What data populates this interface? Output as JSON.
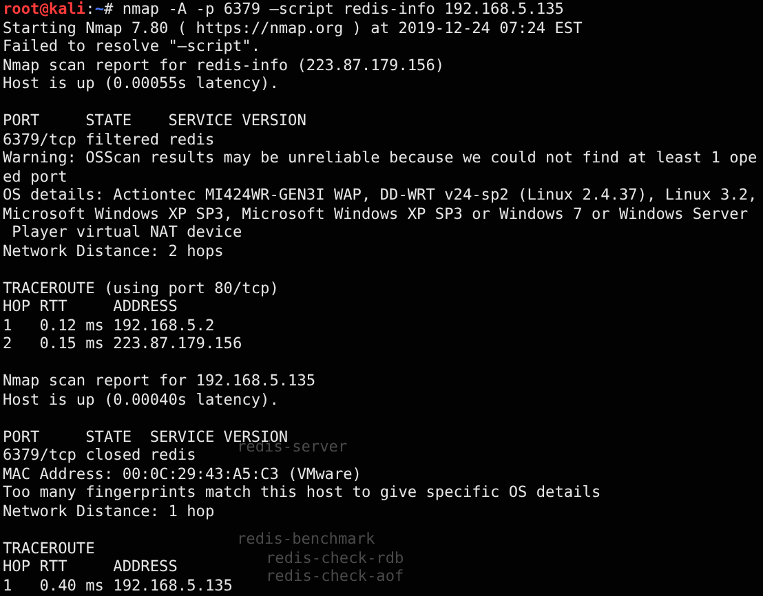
{
  "prompt": {
    "user_host": "root@kali",
    "separator": ":",
    "path": "~",
    "symbol": "#",
    "command": "nmap -A -p 6379 —script redis-info 192.168.5.135"
  },
  "output_blocks": [
    {
      "lines": [
        "Starting Nmap 7.80 ( https://nmap.org ) at 2019-12-24 07:24 EST",
        "Failed to resolve \"—script\".",
        "Nmap scan report for redis-info (223.87.179.156)",
        "Host is up (0.00055s latency)."
      ]
    },
    {
      "lines": [
        "PORT     STATE    SERVICE VERSION",
        "6379/tcp filtered redis",
        "Warning: OSScan results may be unreliable because we could not find at least 1 ope",
        "ed port",
        "OS details: Actiontec MI424WR-GEN3I WAP, DD-WRT v24-sp2 (Linux 2.4.37), Linux 3.2,",
        "Microsoft Windows XP SP3, Microsoft Windows XP SP3 or Windows 7 or Windows Server",
        " Player virtual NAT device",
        "Network Distance: 2 hops"
      ]
    },
    {
      "lines": [
        "TRACEROUTE (using port 80/tcp)",
        "HOP RTT     ADDRESS",
        "1   0.12 ms 192.168.5.2",
        "2   0.15 ms 223.87.179.156"
      ]
    },
    {
      "lines": [
        "Nmap scan report for 192.168.5.135",
        "Host is up (0.00040s latency)."
      ]
    },
    {
      "lines": [
        "PORT     STATE  SERVICE VERSION",
        "6379/tcp closed redis",
        "MAC Address: 00:0C:29:43:A5:C3 (VMware)",
        "Too many fingerprints match this host to give specific OS details",
        "Network Distance: 1 hop"
      ]
    },
    {
      "lines": [
        "TRACEROUTE",
        "HOP RTT     ADDRESS",
        "1   0.40 ms 192.168.5.135"
      ]
    }
  ],
  "background_window": [
    {
      "text": "redis-server"
    },
    {
      "text": "redis-benchmark",
      "children": [
        {
          "text": "redis-check-rdb"
        },
        {
          "text": "redis-check-aof"
        }
      ]
    }
  ]
}
